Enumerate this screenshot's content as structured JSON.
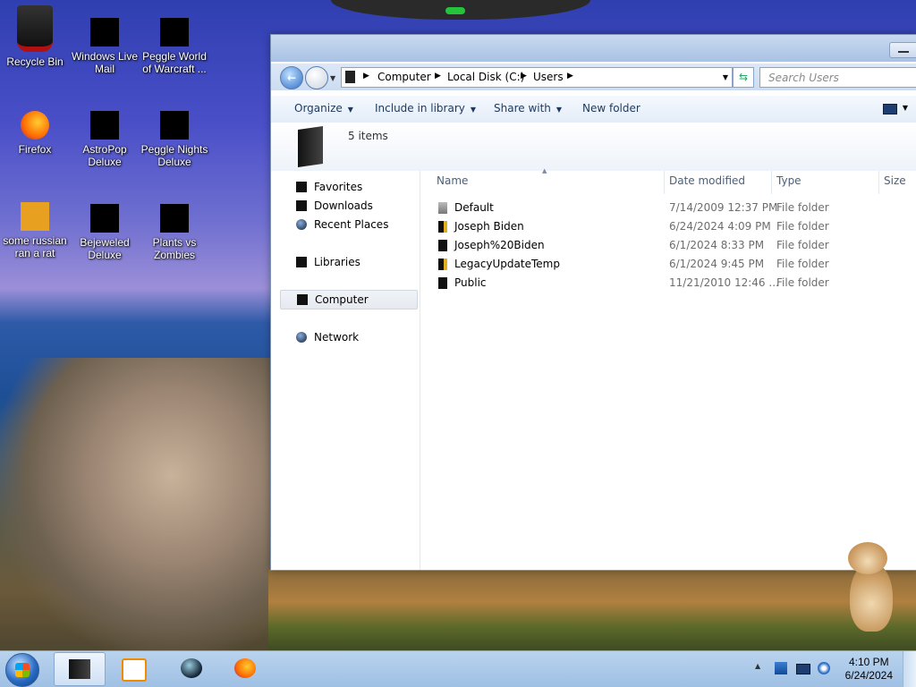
{
  "desktop": {
    "icons": [
      {
        "label": "Recycle Bin",
        "icon": "recycle-bin-icon"
      },
      {
        "label": "Windows Live Mail",
        "icon": "mail-icon"
      },
      {
        "label": "Peggle World of Warcraft ...",
        "icon": "game-icon"
      },
      {
        "label": "Firefox",
        "icon": "firefox-icon"
      },
      {
        "label": "AstroPop Deluxe",
        "icon": "game-icon"
      },
      {
        "label": "Peggle Nights Deluxe",
        "icon": "game-icon"
      },
      {
        "label": "some russian ran a rat",
        "icon": "document-icon"
      },
      {
        "label": "Bejeweled Deluxe",
        "icon": "game-icon"
      },
      {
        "label": "Plants vs Zombies",
        "icon": "game-icon"
      }
    ]
  },
  "explorer": {
    "breadcrumb": [
      "Computer",
      "Local Disk (C:)",
      "Users"
    ],
    "search_placeholder": "Search Users",
    "toolbar": {
      "organize": "Organize",
      "include_in_library": "Include in library",
      "share_with": "Share with",
      "new_folder": "New folder"
    },
    "details": {
      "count": "5 items"
    },
    "nav": {
      "favorites": "Favorites",
      "downloads": "Downloads",
      "recent_places": "Recent Places",
      "libraries": "Libraries",
      "computer": "Computer",
      "network": "Network"
    },
    "columns": {
      "name": "Name",
      "date": "Date modified",
      "type": "Type",
      "size": "Size"
    },
    "rows": [
      {
        "name": "Default",
        "date": "7/14/2009 12:37 PM",
        "type": "File folder"
      },
      {
        "name": "Joseph Biden",
        "date": "6/24/2024 4:09 PM",
        "type": "File folder"
      },
      {
        "name": "Joseph%20Biden",
        "date": "6/1/2024 8:33 PM",
        "type": "File folder"
      },
      {
        "name": "LegacyUpdateTemp",
        "date": "6/1/2024 9:45 PM",
        "type": "File folder"
      },
      {
        "name": "Public",
        "date": "11/21/2010 12:46 ...",
        "type": "File folder"
      }
    ]
  },
  "taskbar": {
    "clock_time": "4:10 PM",
    "clock_date": "6/24/2024",
    "tray_arrow": "▲"
  },
  "colors": {
    "accent": "#1e395b",
    "selection": "#e6eaf0",
    "taskbar": "#b9d3ee"
  }
}
